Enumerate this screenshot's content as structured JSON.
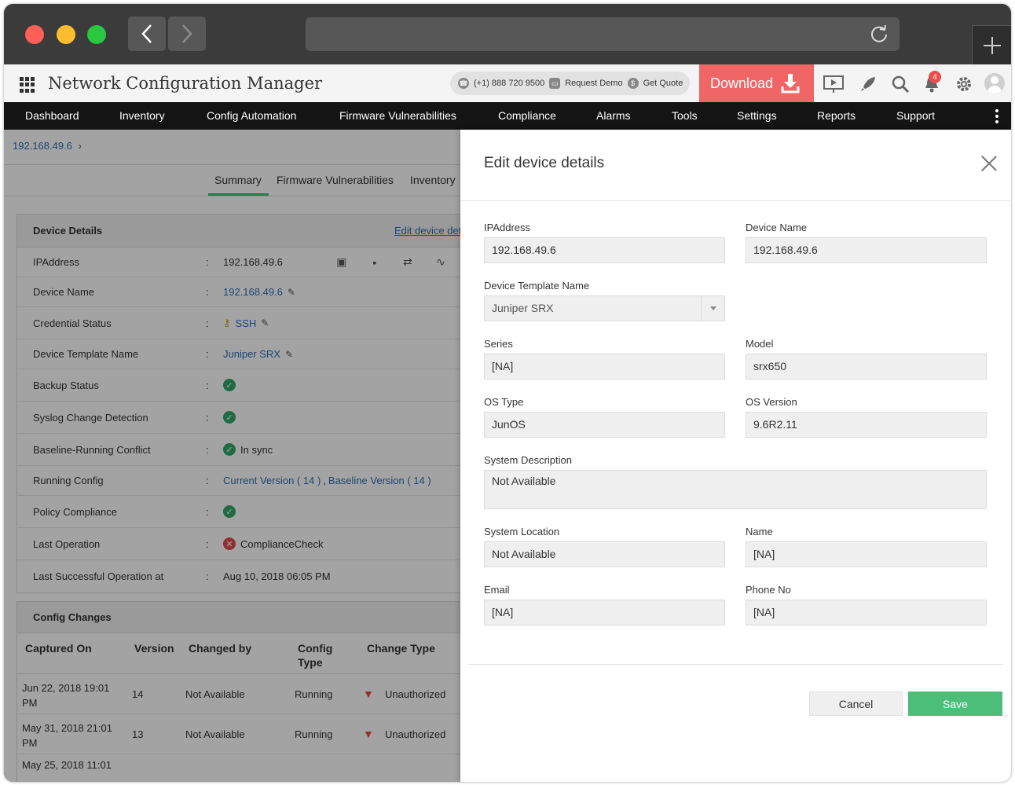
{
  "browser": {
    "back_icon": "chevron-left-icon",
    "forward_icon": "chevron-right-icon",
    "reload_icon": "reload-icon",
    "new_tab_icon": "plus-icon"
  },
  "header": {
    "app_title": "Network Configuration Manager",
    "phone": "(+1) 888 720 9500",
    "request_demo": "Request Demo",
    "get_quote": "Get Quote",
    "download_label": "Download",
    "notification_count": "4",
    "colors": {
      "download_bg": "#f06565",
      "menubar_bg": "#141414"
    }
  },
  "menu": {
    "items": [
      "Dashboard",
      "Inventory",
      "Config Automation",
      "Firmware Vulnerabilities",
      "Compliance",
      "Alarms",
      "Tools",
      "Settings",
      "Reports",
      "Support"
    ]
  },
  "page": {
    "breadcrumb": "192.168.49.6",
    "tabs": [
      "Summary",
      "Firmware Vulnerabilities",
      "Inventory"
    ],
    "active_tab": "Summary",
    "device_details": {
      "title": "Device Details",
      "edit_link": "Edit device details",
      "rows": [
        {
          "label": "IPAddress",
          "value": "192.168.49.6"
        },
        {
          "label": "Device Name",
          "value": "192.168.49.6"
        },
        {
          "label": "Credential Status",
          "value": "SSH"
        },
        {
          "label": "Device Template Name",
          "value": "Juniper SRX"
        },
        {
          "label": "Backup Status",
          "value": ""
        },
        {
          "label": "Syslog Change Detection",
          "value": ""
        },
        {
          "label": "Baseline-Running Conflict",
          "value": "In sync"
        },
        {
          "label": "Running Config",
          "value": "Current Version ( 14 )",
          "value2": "Baseline Version ( 14 )",
          "separator": ","
        },
        {
          "label": "Policy Compliance",
          "value": ""
        },
        {
          "label": "Last Operation",
          "value": "ComplianceCheck"
        },
        {
          "label": "Last Successful Operation at",
          "value": "Aug 10, 2018 06:05 PM"
        }
      ]
    },
    "config_changes": {
      "title": "Config Changes",
      "columns": [
        "Captured On",
        "Version",
        "Changed by",
        "Config Type",
        "Change Type"
      ],
      "rows": [
        {
          "captured": "Jun 22, 2018 19:01 PM",
          "version": "14",
          "changed_by": "Not Available",
          "config_type": "Running",
          "change_type": "Unauthorized"
        },
        {
          "captured": "May 31, 2018 21:01 PM",
          "version": "13",
          "changed_by": "Not Available",
          "config_type": "Running",
          "change_type": "Unauthorized"
        },
        {
          "captured": "May 25, 2018 11:01",
          "version": "",
          "changed_by": "",
          "config_type": "",
          "change_type": ""
        }
      ]
    }
  },
  "modal": {
    "title": "Edit device details",
    "fields": {
      "ip_label": "IPAddress",
      "ip_value": "192.168.49.6",
      "device_name_label": "Device Name",
      "device_name_value": "192.168.49.6",
      "template_label": "Device Template Name",
      "template_value": "Juniper SRX",
      "series_label": "Series",
      "series_value": "[NA]",
      "model_label": "Model",
      "model_value": "srx650",
      "os_type_label": "OS Type",
      "os_type_value": "JunOS",
      "os_version_label": "OS Version",
      "os_version_value": "9.6R2.11",
      "sysdesc_label": "System Description",
      "sysdesc_value": "Not Available",
      "sysloc_label": "System Location",
      "sysloc_value": "Not Available",
      "name_label": "Name",
      "name_value": "[NA]",
      "email_label": "Email",
      "email_value": "[NA]",
      "phone_label": "Phone No",
      "phone_value": "[NA]"
    },
    "cancel_label": "Cancel",
    "save_label": "Save",
    "colors": {
      "save_bg": "#4cbe79"
    }
  }
}
